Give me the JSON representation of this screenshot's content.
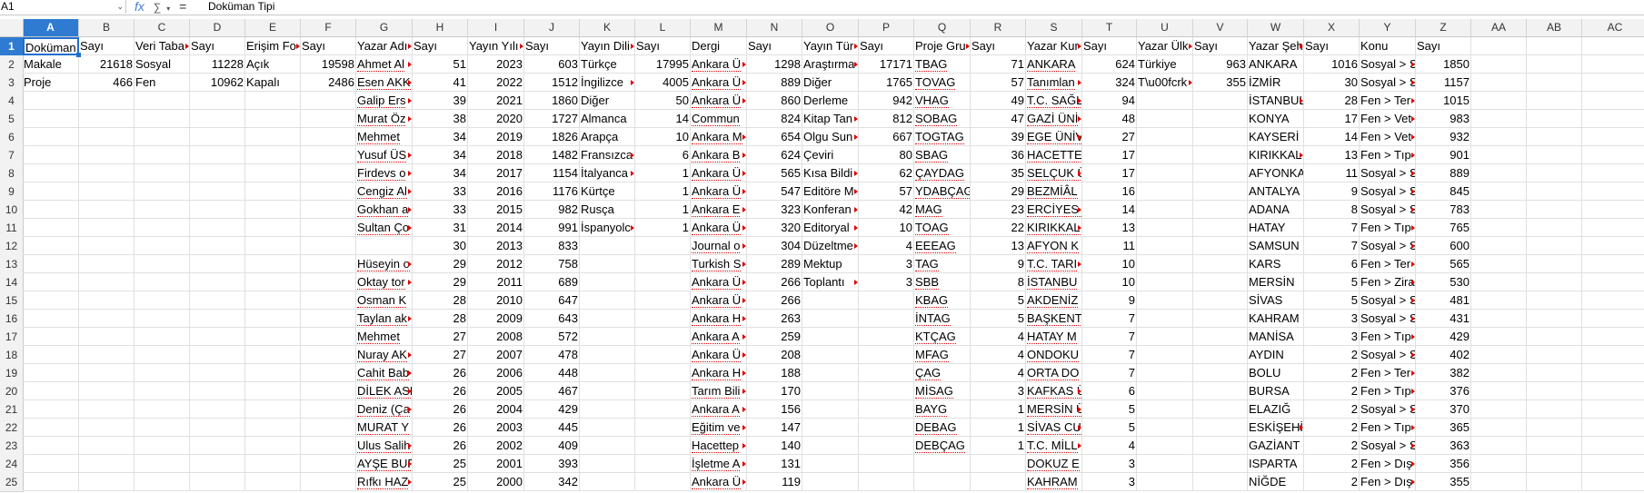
{
  "formula_bar": {
    "name_box": "A1",
    "formula_value": "Doküman Tipi",
    "fx_icon": "fx-icon",
    "sum_icon": "sum-icon",
    "equals_icon": "equals-icon"
  },
  "columns": [
    "A",
    "B",
    "C",
    "D",
    "E",
    "F",
    "G",
    "H",
    "I",
    "J",
    "K",
    "L",
    "M",
    "N",
    "O",
    "P",
    "Q",
    "R",
    "S",
    "T",
    "U",
    "V",
    "W",
    "X",
    "Y",
    "Z",
    "AA",
    "AB",
    "AC"
  ],
  "rows": [
    [
      "Doküman",
      "Sayı",
      "Veri Taba",
      "Sayı",
      "Erişim Fo",
      "Sayı",
      "Yazar Adı",
      "Sayı",
      "Yayın Yılı",
      "Sayı",
      "Yayın Dili",
      "Sayı",
      "Dergi",
      "Sayı",
      "Yayın Tür",
      "Sayı",
      "Proje Gru",
      "Sayı",
      "Yazar Kur",
      "Sayı",
      "Yazar Ülk",
      "Sayı",
      "Yazar Şeh",
      "Sayı",
      "Konu",
      "Sayı",
      "",
      "",
      ""
    ],
    [
      "Makale",
      "21618",
      "Sosyal",
      "11228",
      "Açık",
      "19598",
      "Ahmet Al",
      "51",
      "2023",
      "603",
      "Türkçe",
      "17995",
      "Ankara Ü",
      "1298",
      "Araştırma",
      "17171",
      "TBAG",
      "71",
      "ANKARA",
      "624",
      "Türkiye",
      "963",
      "ANKARA",
      "1016",
      "Sosyal > S",
      "1850",
      "",
      "",
      ""
    ],
    [
      "Proje",
      "466",
      "Fen",
      "10962",
      "Kapalı",
      "2486",
      "Esen AKK",
      "41",
      "2022",
      "1512",
      "İngilizce",
      "4005",
      "Ankara Ü",
      "889",
      "Diğer",
      "1765",
      "TOVAG",
      "57",
      "Tanımlan",
      "324",
      "T\\u00fcrk",
      "355",
      "İZMİR",
      "30",
      "Sosyal > S",
      "1157",
      "",
      "",
      ""
    ],
    [
      "",
      "",
      "",
      "",
      "",
      "",
      "Galip Ers",
      "39",
      "2021",
      "1860",
      "Diğer",
      "50",
      "Ankara Ü",
      "860",
      "Derleme",
      "942",
      "VHAG",
      "49",
      "T.C. SAĞL",
      "94",
      "",
      "",
      "İSTANBUL",
      "28",
      "Fen > Ter",
      "1015",
      "",
      "",
      ""
    ],
    [
      "",
      "",
      "",
      "",
      "",
      "",
      "Murat Öz",
      "38",
      "2020",
      "1727",
      "Almanca",
      "14",
      "Commun",
      "824",
      "Kitap Tan",
      "812",
      "SOBAG",
      "47",
      "GAZİ ÜNİ",
      "48",
      "",
      "",
      "KONYA",
      "17",
      "Fen > Vet",
      "983",
      "",
      "",
      ""
    ],
    [
      "",
      "",
      "",
      "",
      "",
      "",
      "Mehmet",
      "34",
      "2019",
      "1826",
      "Arapça",
      "10",
      "Ankara M",
      "654",
      "Olgu Sun",
      "667",
      "TOGTAG",
      "39",
      "EGE ÜNİV",
      "27",
      "",
      "",
      "KAYSERİ",
      "14",
      "Fen > Vet",
      "932",
      "",
      "",
      ""
    ],
    [
      "",
      "",
      "",
      "",
      "",
      "",
      "Yusuf ÜS",
      "34",
      "2018",
      "1482",
      "Fransızca",
      "6",
      "Ankara B",
      "624",
      "Çeviri",
      "80",
      "SBAG",
      "36",
      "HACETTE",
      "17",
      "",
      "",
      "KIRIKKAL",
      "13",
      "Fen > Tıp",
      "901",
      "",
      "",
      ""
    ],
    [
      "",
      "",
      "",
      "",
      "",
      "",
      "Firdevs o",
      "34",
      "2017",
      "1154",
      "İtalyanca",
      "1",
      "Ankara Ü",
      "565",
      "Kısa Bildi",
      "62",
      "ÇAYDAG",
      "35",
      "SELÇUK Ü",
      "17",
      "",
      "",
      "AFYONKA",
      "11",
      "Sosyal > S",
      "889",
      "",
      "",
      ""
    ],
    [
      "",
      "",
      "",
      "",
      "",
      "",
      "Cengiz Al",
      "33",
      "2016",
      "1176",
      "Kürtçe",
      "1",
      "Ankara Ü",
      "547",
      "Editöre M",
      "57",
      "YDABÇAG",
      "29",
      "BEZMİÂL",
      "16",
      "",
      "",
      "ANTALYA",
      "9",
      "Sosyal > S",
      "845",
      "",
      "",
      ""
    ],
    [
      "",
      "",
      "",
      "",
      "",
      "",
      "Gokhan a",
      "33",
      "2015",
      "982",
      "Rusça",
      "1",
      "Ankara E",
      "323",
      "Konferan",
      "42",
      "MAG",
      "23",
      "ERCİYES Ü",
      "14",
      "",
      "",
      "ADANA",
      "8",
      "Sosyal > S",
      "783",
      "",
      "",
      ""
    ],
    [
      "",
      "",
      "",
      "",
      "",
      "",
      "Sultan Ço",
      "31",
      "2014",
      "991",
      "İspanyolc",
      "1",
      "Ankara Ü",
      "320",
      "Editoryal",
      "10",
      "TOAG",
      "22",
      "KIRIKKAL",
      "13",
      "",
      "",
      "HATAY",
      "7",
      "Fen > Tıp",
      "765",
      "",
      "",
      ""
    ],
    [
      "",
      "",
      "",
      "",
      "",
      "",
      "",
      "30",
      "2013",
      "833",
      "",
      "",
      "Journal o",
      "304",
      "Düzeltme",
      "4",
      "EEEAG",
      "13",
      "AFYON K",
      "11",
      "",
      "",
      "SAMSUN",
      "7",
      "Sosyal > S",
      "600",
      "",
      "",
      ""
    ],
    [
      "",
      "",
      "",
      "",
      "",
      "",
      "Hüseyin o",
      "29",
      "2012",
      "758",
      "",
      "",
      "Turkish S",
      "289",
      "Mektup",
      "3",
      "TAG",
      "9",
      "T.C. TARI",
      "10",
      "",
      "",
      "KARS",
      "6",
      "Fen > Ter",
      "565",
      "",
      "",
      ""
    ],
    [
      "",
      "",
      "",
      "",
      "",
      "",
      "Oktay tor",
      "29",
      "2011",
      "689",
      "",
      "",
      "Ankara Ü",
      "266",
      "Toplantı",
      "3",
      "SBB",
      "8",
      "İSTANBU",
      "10",
      "",
      "",
      "MERSİN",
      "5",
      "Fen > Zira",
      "530",
      "",
      "",
      ""
    ],
    [
      "",
      "",
      "",
      "",
      "",
      "",
      "Osman K",
      "28",
      "2010",
      "647",
      "",
      "",
      "Ankara Ü",
      "266",
      "",
      "",
      "KBAG",
      "5",
      "AKDENİZ",
      "9",
      "",
      "",
      "SİVAS",
      "5",
      "Sosyal > S",
      "481",
      "",
      "",
      ""
    ],
    [
      "",
      "",
      "",
      "",
      "",
      "",
      "Taylan ak",
      "28",
      "2009",
      "643",
      "",
      "",
      "Ankara H",
      "263",
      "",
      "",
      "İNTAG",
      "5",
      "BAŞKENT",
      "7",
      "",
      "",
      "KAHRAM",
      "3",
      "Sosyal > S",
      "431",
      "",
      "",
      ""
    ],
    [
      "",
      "",
      "",
      "",
      "",
      "",
      "Mehmet",
      "27",
      "2008",
      "572",
      "",
      "",
      "Ankara A",
      "259",
      "",
      "",
      "KTÇAG",
      "4",
      "HATAY M",
      "7",
      "",
      "",
      "MANİSA",
      "3",
      "Fen > Tıp",
      "429",
      "",
      "",
      ""
    ],
    [
      "",
      "",
      "",
      "",
      "",
      "",
      "Nuray AK",
      "27",
      "2007",
      "478",
      "",
      "",
      "Ankara Ü",
      "208",
      "",
      "",
      "MFAG",
      "4",
      "ONDOKU",
      "7",
      "",
      "",
      "AYDIN",
      "2",
      "Sosyal > S",
      "402",
      "",
      "",
      ""
    ],
    [
      "",
      "",
      "",
      "",
      "",
      "",
      "Cahit Bab",
      "26",
      "2006",
      "448",
      "",
      "",
      "Ankara H",
      "188",
      "",
      "",
      "ÇAG",
      "4",
      "ORTA DO",
      "7",
      "",
      "",
      "BOLU",
      "2",
      "Fen > Ter",
      "382",
      "",
      "",
      ""
    ],
    [
      "",
      "",
      "",
      "",
      "",
      "",
      "DİLEK ASI",
      "26",
      "2005",
      "467",
      "",
      "",
      "Tarım Bili",
      "170",
      "",
      "",
      "MİSAG",
      "3",
      "KAFKAS Ü",
      "6",
      "",
      "",
      "BURSA",
      "2",
      "Fen > Tıp",
      "376",
      "",
      "",
      ""
    ],
    [
      "",
      "",
      "",
      "",
      "",
      "",
      "Deniz (Ça",
      "26",
      "2004",
      "429",
      "",
      "",
      "Ankara A",
      "156",
      "",
      "",
      "BAYG",
      "1",
      "MERSİN Ü",
      "5",
      "",
      "",
      "ELAZIĞ",
      "2",
      "Sosyal > S",
      "370",
      "",
      "",
      ""
    ],
    [
      "",
      "",
      "",
      "",
      "",
      "",
      "MURAT Y",
      "26",
      "2003",
      "445",
      "",
      "",
      "Eğitim ve",
      "147",
      "",
      "",
      "DEBAG",
      "1",
      "SİVAS CU",
      "5",
      "",
      "",
      "ESKİŞEHİR",
      "2",
      "Fen > Tıp",
      "365",
      "",
      "",
      ""
    ],
    [
      "",
      "",
      "",
      "",
      "",
      "",
      "Ulus Salih",
      "26",
      "2002",
      "409",
      "",
      "",
      "Hacettep",
      "140",
      "",
      "",
      "DEBÇAG",
      "1",
      "T.C. MİLL",
      "4",
      "",
      "",
      "GAZİANT",
      "2",
      "Sosyal > S",
      "363",
      "",
      "",
      ""
    ],
    [
      "",
      "",
      "",
      "",
      "",
      "",
      "AYŞE BUR",
      "25",
      "2001",
      "393",
      "",
      "",
      "İşletme A",
      "131",
      "",
      "",
      "",
      "",
      "DOKUZ E",
      "3",
      "",
      "",
      "ISPARTA",
      "2",
      "Fen > Dış",
      "356",
      "",
      "",
      ""
    ],
    [
      "",
      "",
      "",
      "",
      "",
      "",
      "Rıfkı HAZ",
      "25",
      "2000",
      "342",
      "",
      "",
      "Ankara Ü",
      "119",
      "",
      "",
      "",
      "",
      "KAHRAM",
      "3",
      "",
      "",
      "NİĞDE",
      "2",
      "Fen > Dış",
      "355",
      "",
      "",
      ""
    ]
  ]
}
